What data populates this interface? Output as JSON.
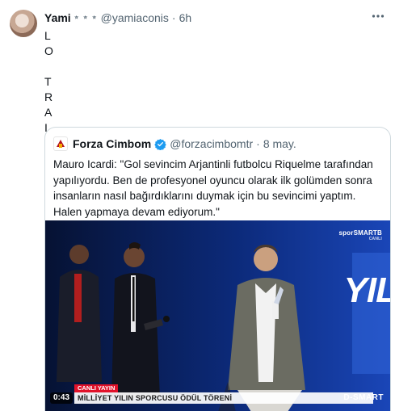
{
  "tweet": {
    "display_name": "Yami",
    "name_decoration": "⭒ ⭒ ⭒",
    "handle": "@yamiaconis",
    "separator": "·",
    "time": "6h",
    "lines": [
      "L",
      "O",
      "",
      "T",
      "R",
      "A",
      "I"
    ]
  },
  "quote": {
    "display_name": "Forza Cimbom",
    "verified": true,
    "handle": "@forzacimbomtr",
    "separator": "·",
    "time": "8 may.",
    "text": "Mauro Icardi: \"Gol sevincim Arjantinli futbolcu Riquelme tarafından yapılıyordu. Ben de profesyonel oyuncu olarak ilk golümden sonra insanların nasıl bağırdıklarını duymak için bu sevincimi yaptım. Halen yapmaya devam ediyorum.\"",
    "media": {
      "channel_logo": "sporSMARTB",
      "channel_sub": "CANLI",
      "big_text": "YIL",
      "live_badge": "CANLI YAYIN",
      "ticker": "MİLLİYET YILIN SPORCUSU ÖDÜL TÖRENİ",
      "duration": "0:43",
      "brand": "D-SMART"
    }
  },
  "colors": {
    "text": "#0f1419",
    "secondary": "#536471",
    "border": "#cfd9de",
    "verified": "#1d9bf0",
    "live": "#e1122a"
  },
  "icons": [
    "more-icon",
    "verified-icon",
    "avatar"
  ]
}
